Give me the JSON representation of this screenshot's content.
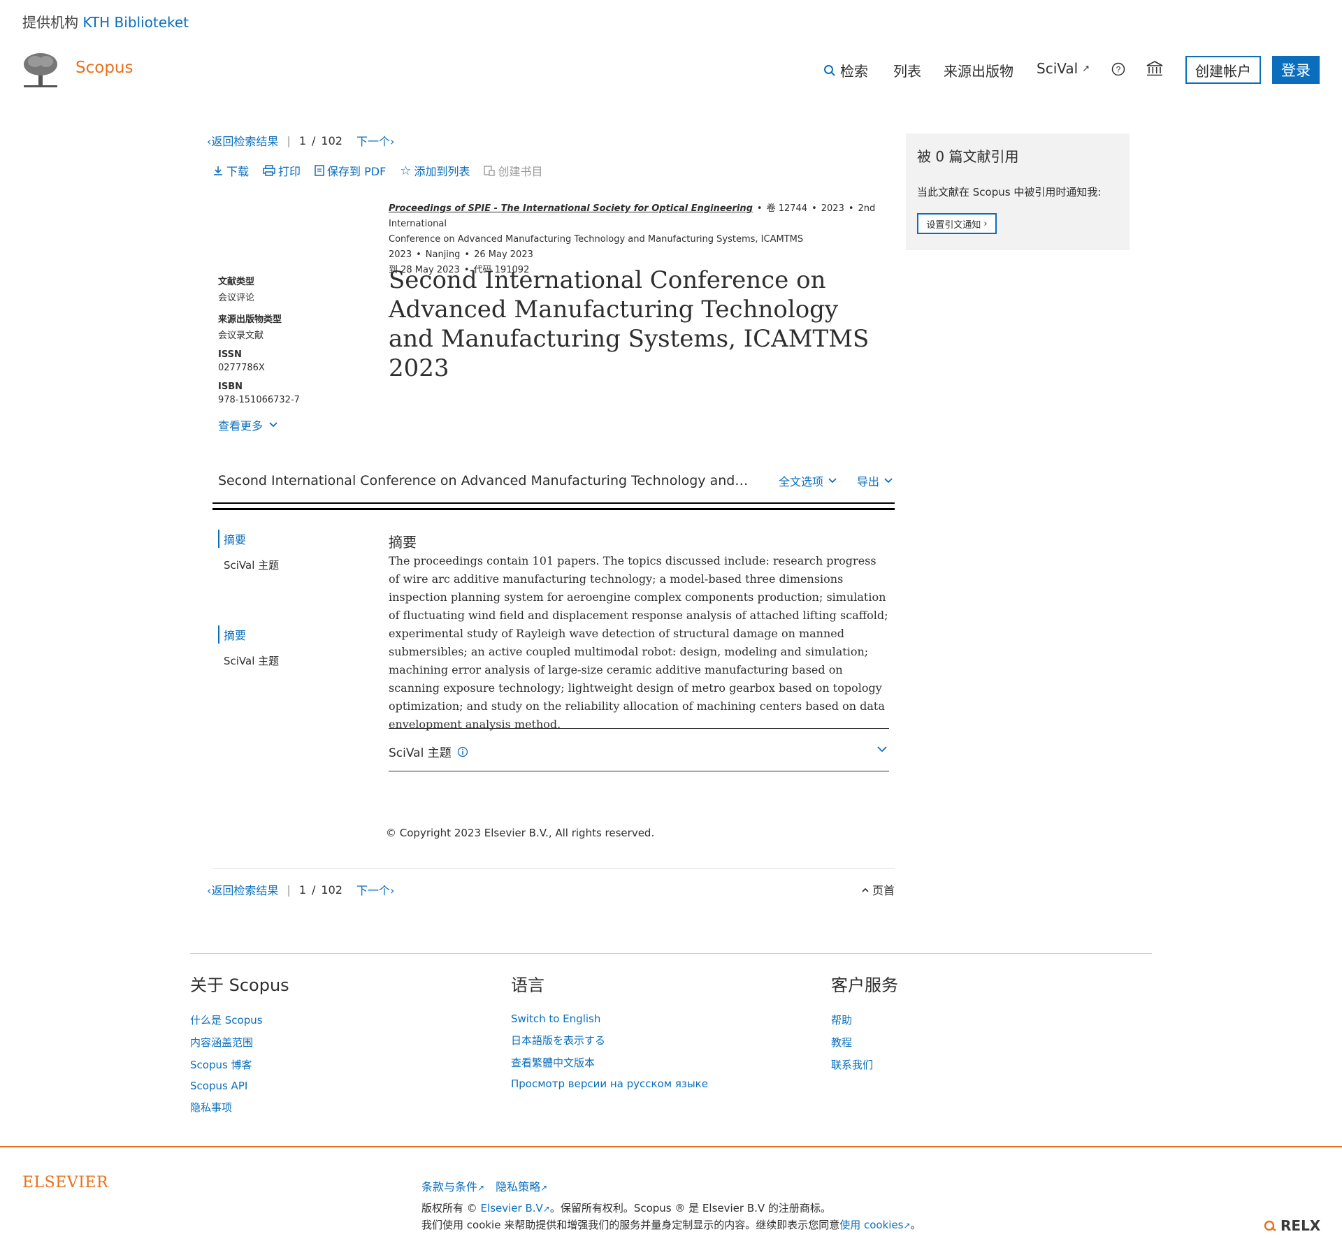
{
  "institution": {
    "prefix": "提供机构",
    "name": "KTH Biblioteket"
  },
  "header": {
    "logo_text": "Scopus",
    "nav": {
      "search": "检索",
      "lists": "列表",
      "sources": "来源出版物",
      "scival": "SciVal"
    },
    "create_account": "创建帐户",
    "login": "登录"
  },
  "docnav": {
    "back": "返回检索结果",
    "current": "1",
    "slash": "/",
    "total": "102",
    "next": "下一个"
  },
  "toolbar": {
    "download": "下载",
    "print": "打印",
    "save_pdf": "保存到 PDF",
    "add_to_list": "添加到列表",
    "create_bibliography": "创建书目"
  },
  "source": {
    "journal": "Proceedings of SPIE - The International Society for Optical Engineering",
    "volume": "卷 12744",
    "year": "2023",
    "conference_prefix": "2nd International",
    "conference_rest": "Conference on Advanced Manufacturing Technology and Manufacturing Systems, ICAMTMS 2023",
    "location": "Nanjing",
    "date_start": "26 May 2023",
    "date_end": "到 28 May 2023",
    "code": "代码 191092"
  },
  "meta": {
    "doc_type_label": "文献类型",
    "doc_type": "会议评论",
    "source_type_label": "来源出版物类型",
    "source_type": "会议录文献",
    "issn_label": "ISSN",
    "issn": "0277786X",
    "isbn_label": "ISBN",
    "isbn": "978-151066732-7",
    "see_more": "查看更多"
  },
  "title": "Second International Conference on Advanced Manufacturing Technology and Manufacturing Systems, ICAMTMS 2023",
  "cited_by": {
    "title": "被 0 篇文献引用",
    "note": "当此文献在 Scopus 中被引用时通知我:",
    "button": "设置引文通知"
  },
  "sticky": {
    "title": "Second International Conference on Advanced Manufacturing Technology and…",
    "fulltext_options": "全文选项",
    "export": "导出"
  },
  "toc": {
    "abstract": "摘要",
    "scival": "SciVal 主题"
  },
  "abstract": {
    "heading": "摘要",
    "text": "The proceedings contain 101 papers. The topics discussed include: research progress of wire arc additive manufacturing technology; a model-based three dimensions inspection planning system for aeroengine complex components production; simulation of fluctuating wind field and displacement response analysis of attached lifting scaffold; experimental study of Rayleigh wave detection of structural damage on manned submersibles; an active coupled multimodal robot: design, modeling and simulation; machining error analysis of large-size ceramic additive manufacturing based on scanning exposure technology; lightweight design of metro gearbox based on topology optimization; and study on the reliability allocation of machining centers based on data envelopment analysis method."
  },
  "scival_topics": {
    "label": "SciVal 主题"
  },
  "copyright": "© Copyright 2023 Elsevier B.V., All rights reserved.",
  "top_link": "页首",
  "footer": {
    "about": {
      "heading": "关于 Scopus",
      "links": [
        "什么是 Scopus",
        "内容涵盖范围",
        "Scopus 博客",
        "Scopus API",
        "隐私事项"
      ]
    },
    "language": {
      "heading": "语言",
      "links": [
        "Switch to English",
        "日本語版を表示する",
        "查看繁體中文版本",
        "Просмотр версии на русском языке"
      ]
    },
    "service": {
      "heading": "客户服务",
      "links": [
        "帮助",
        "教程",
        "联系我们"
      ]
    }
  },
  "legal": {
    "elsevier_logo": "ELSEVIER",
    "terms": "条款与条件",
    "privacy": "隐私策略",
    "line1_prefix": "版权所有 © ",
    "line1_link": "Elsevier B.V",
    "line1_suffix": "。保留所有权利。Scopus ® 是 Elsevier B.V 的注册商标。",
    "line2_prefix": "我们使用 cookie 来帮助提供和增强我们的服务并量身定制显示的内容。继续即表示您同意",
    "line2_link": "使用 cookies",
    "line2_suffix": "。",
    "relx": "RELX"
  },
  "colors": {
    "accent": "#0a6ebd",
    "brand": "#e9711c",
    "text": "#2e2e2e",
    "panel": "#f2f2f2"
  }
}
